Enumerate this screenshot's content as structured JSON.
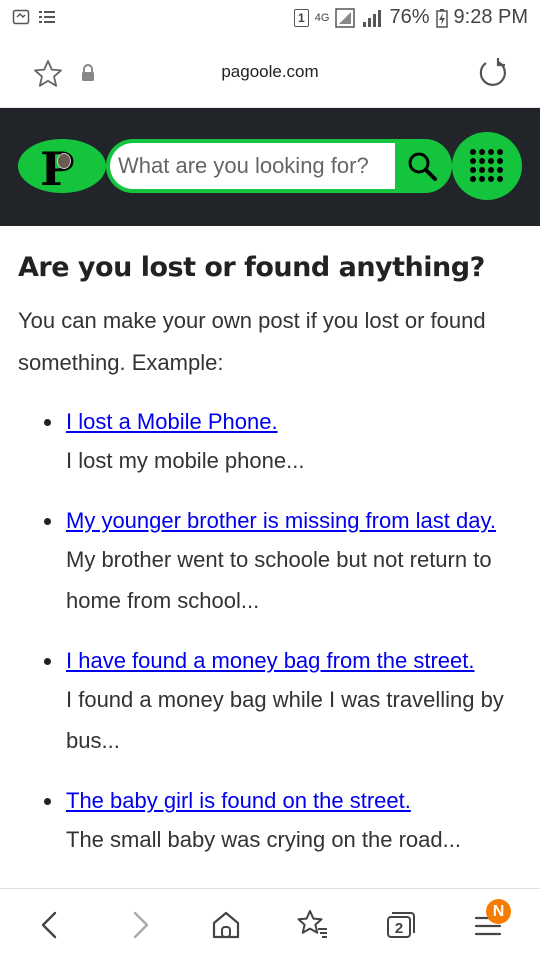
{
  "status_bar": {
    "network": "4G",
    "battery": "76%",
    "time": "9:28 PM",
    "sim_slot": "1"
  },
  "browser": {
    "url": "pagoole.com",
    "icons": {
      "bookmark": "star-icon",
      "security": "lock-icon",
      "reload": "reload-icon"
    }
  },
  "header": {
    "logo_letter": "P",
    "search_placeholder": "What are you looking for?",
    "accent_color": "#14c43d",
    "background_color": "#212529"
  },
  "main": {
    "title": "Are you lost or found anything?",
    "intro": "You can make your own post if you lost or found something. Example:",
    "posts": [
      {
        "link": "I lost a Mobile Phone.",
        "desc": "I lost my mobile phone..."
      },
      {
        "link": "My younger brother is missing from last day.",
        "desc": "My brother went to schoole but not return to home from school..."
      },
      {
        "link": "I have found a money bag from the street.",
        "desc": "I found a money bag while I was travelling by bus..."
      },
      {
        "link": "The baby girl is found on the street.",
        "desc": "The small baby was crying on the road..."
      }
    ]
  },
  "bottom_nav": {
    "tabs_count": "2",
    "notification_badge": "N",
    "badge_color": "#f57c00"
  }
}
